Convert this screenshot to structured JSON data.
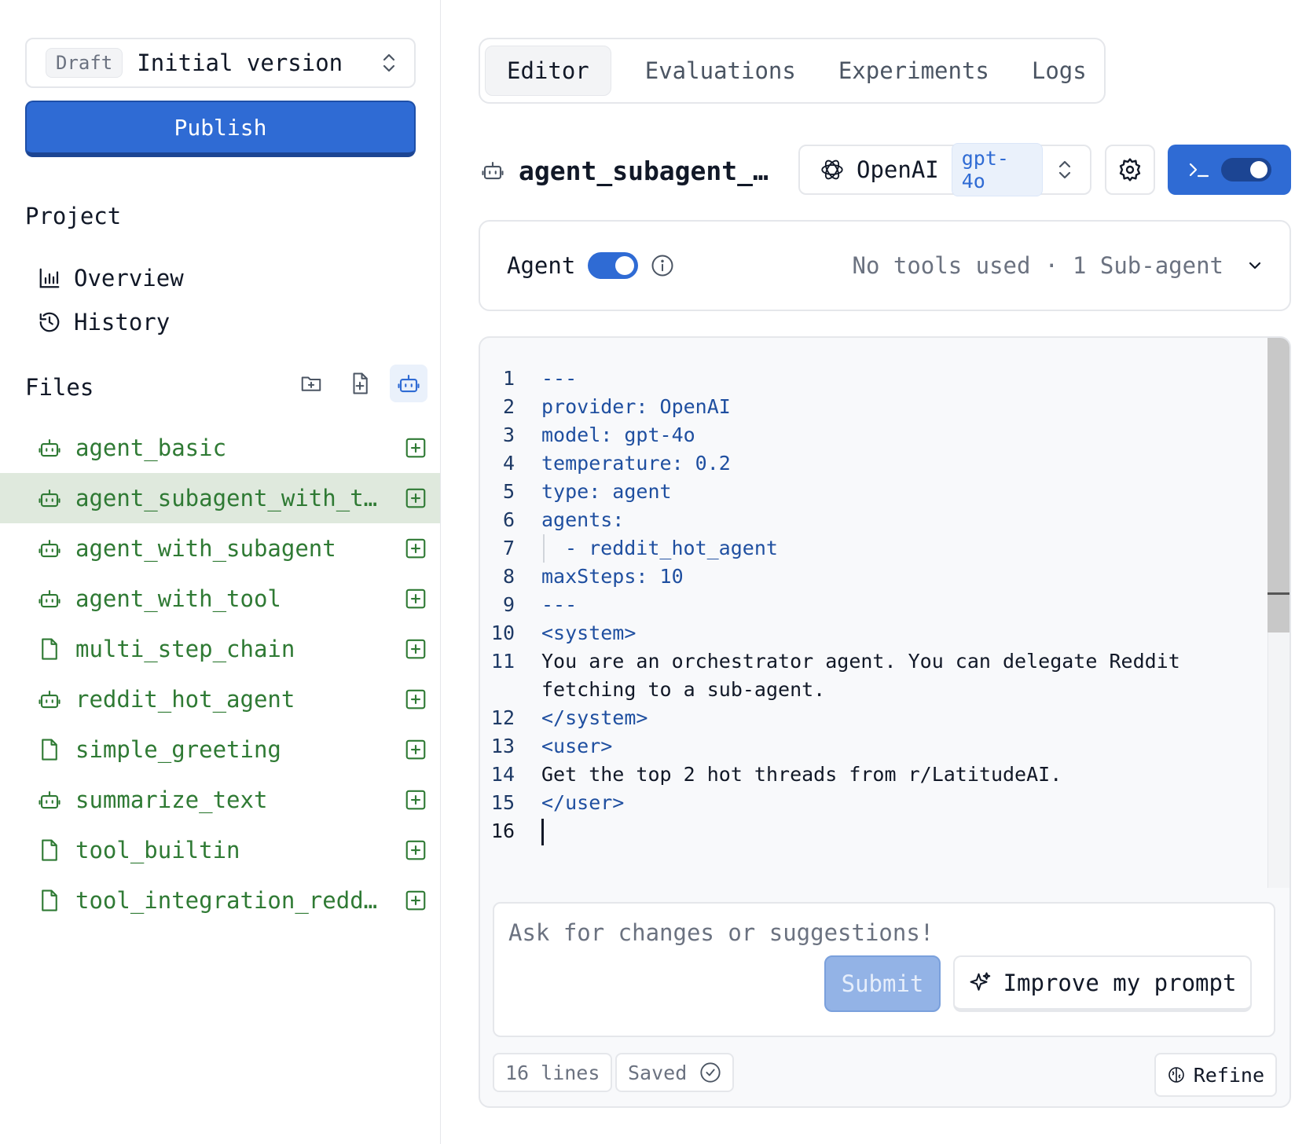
{
  "sidebar": {
    "version": {
      "badge": "Draft",
      "name": "Initial version"
    },
    "publish_label": "Publish",
    "project_title": "Project",
    "nav": [
      {
        "label": "Overview",
        "icon": "bar-chart-icon"
      },
      {
        "label": "History",
        "icon": "history-icon"
      }
    ],
    "files_title": "Files",
    "files": [
      {
        "name": "agent_basic",
        "type": "agent"
      },
      {
        "name": "agent_subagent_with_to…",
        "type": "agent",
        "selected": true
      },
      {
        "name": "agent_with_subagent",
        "type": "agent"
      },
      {
        "name": "agent_with_tool",
        "type": "agent"
      },
      {
        "name": "multi_step_chain",
        "type": "file"
      },
      {
        "name": "reddit_hot_agent",
        "type": "agent"
      },
      {
        "name": "simple_greeting",
        "type": "file"
      },
      {
        "name": "summarize_text",
        "type": "agent"
      },
      {
        "name": "tool_builtin",
        "type": "file"
      },
      {
        "name": "tool_integration_reddit",
        "type": "file"
      }
    ]
  },
  "tabs": [
    "Editor",
    "Evaluations",
    "Experiments",
    "Logs"
  ],
  "document": {
    "title": "agent_subagent_…",
    "provider": "OpenAI",
    "model": "gpt-4o"
  },
  "agent_bar": {
    "label": "Agent",
    "tools": "No tools used",
    "separator": "·",
    "subagents": "1 Sub-agent"
  },
  "code_lines": [
    {
      "n": "1",
      "text": "---"
    },
    {
      "n": "2",
      "text": "provider: OpenAI"
    },
    {
      "n": "3",
      "text": "model: gpt-4o"
    },
    {
      "n": "4",
      "text": "temperature: 0.2"
    },
    {
      "n": "5",
      "text": "type: agent"
    },
    {
      "n": "6",
      "text": "agents:"
    },
    {
      "n": "7",
      "text": "- reddit_hot_agent",
      "indent": true
    },
    {
      "n": "8",
      "text": "maxSteps: 10"
    },
    {
      "n": "9",
      "text": "---"
    },
    {
      "n": "10",
      "text": "<system>"
    },
    {
      "n": "11",
      "text": "You are an orchestrator agent. You can delegate Reddit",
      "plain": true
    },
    {
      "n": "",
      "text": "fetching to a sub-agent.",
      "plain": true
    },
    {
      "n": "12",
      "text": "</system>"
    },
    {
      "n": "13",
      "text": "<user>"
    },
    {
      "n": "14",
      "text": "Get the top 2 hot threads from r/LatitudeAI.",
      "plain": true
    },
    {
      "n": "15",
      "text": "</user>"
    },
    {
      "n": "16",
      "text": "",
      "cursor": true
    }
  ],
  "chat": {
    "placeholder": "Ask for changes or suggestions!",
    "submit_label": "Submit",
    "improve_label": "Improve my prompt"
  },
  "footer": {
    "lines": "16 lines",
    "status": "Saved",
    "refine_label": "Refine"
  }
}
